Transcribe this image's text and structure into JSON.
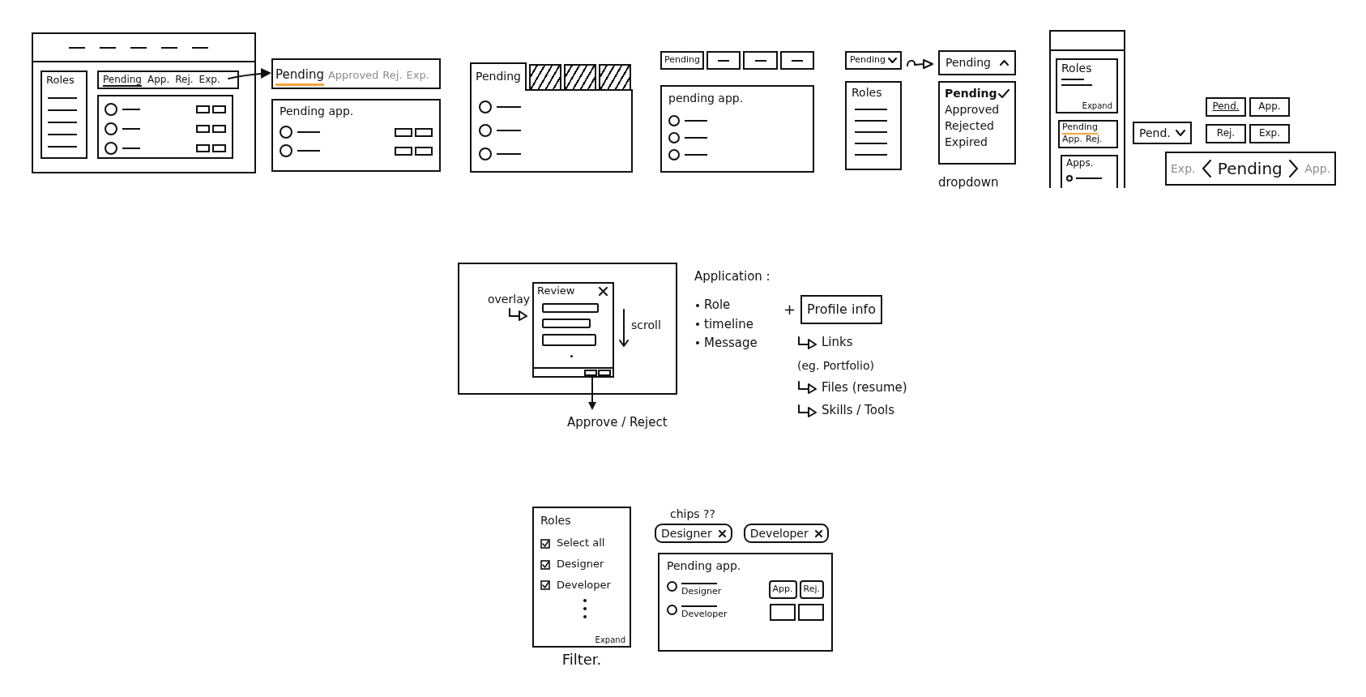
{
  "layout_sketch": {
    "sidebar_title": "Roles",
    "tabs": [
      {
        "label": "Pending",
        "selected": true
      },
      {
        "label": "App.",
        "selected": false
      },
      {
        "label": "Rej.",
        "selected": false
      },
      {
        "label": "Exp.",
        "selected": false
      }
    ]
  },
  "tab_detail": {
    "tabs": [
      {
        "label": "Pending",
        "selected": true
      },
      {
        "label": "Approved",
        "selected": false
      },
      {
        "label": "Rej.",
        "selected": false
      },
      {
        "label": "Exp.",
        "selected": false
      }
    ],
    "list_title": "Pending app."
  },
  "folder_tabs": {
    "tabs": [
      {
        "label": "Pending",
        "selected": true
      },
      {
        "selected": false
      },
      {
        "selected": false
      },
      {
        "selected": false
      }
    ]
  },
  "box_tabs": {
    "tabs": [
      {
        "kind": "text",
        "label": "Pending"
      },
      {
        "kind": "dash"
      },
      {
        "kind": "dash"
      },
      {
        "kind": "dash"
      }
    ],
    "list_title": "pending app."
  },
  "dropdown_sketch": {
    "dropdowns": [
      {
        "value": "Pending",
        "expanded": false
      },
      {
        "value": "Pending",
        "expanded": true
      }
    ],
    "sidebar_title": "Roles",
    "options": [
      {
        "label": "Pending",
        "selected": true
      },
      {
        "label": "Approved",
        "selected": false
      },
      {
        "label": "Rejected",
        "selected": false
      },
      {
        "label": "Expired",
        "selected": false
      }
    ],
    "caption": "dropdown"
  },
  "mobile_sketch": {
    "roles_card": {
      "title": "Roles",
      "action": "Expand"
    },
    "tabs": [
      {
        "label": "Pending",
        "selected": true
      },
      {
        "label": "App.",
        "selected": false
      },
      {
        "label": "Rej.",
        "selected": false
      }
    ],
    "apps_card": {
      "title": "Apps."
    }
  },
  "compact_dropdown": {
    "value": "Pend.",
    "expanded": false
  },
  "button_grid": [
    {
      "label": "Pend.",
      "selected": true
    },
    {
      "label": "App.",
      "selected": false
    },
    {
      "label": "Rej.",
      "selected": false
    },
    {
      "label": "Exp.",
      "selected": false
    }
  ],
  "carousel": {
    "previous": "Exp.",
    "current": "Pending",
    "next": "App."
  },
  "review_sketch": {
    "overlay_label": "overlay",
    "modal_title": "Review",
    "scroll_label": "scroll",
    "outcome": "Approve / Reject"
  },
  "application_notes": {
    "title": "Application :",
    "fields": [
      "Role",
      "timeline",
      "Message"
    ],
    "joiner": "+",
    "profile_title": "Profile info",
    "profile_items": [
      {
        "label": "Links",
        "note": "(eg. Portfolio)"
      },
      {
        "label": "Files (resume)"
      },
      {
        "label": "Skills / Tools"
      }
    ]
  },
  "filter_sketch": {
    "panel_title": "Roles",
    "options": [
      {
        "label": "Select all",
        "checked": true
      },
      {
        "label": "Designer",
        "checked": true
      },
      {
        "label": "Developer",
        "checked": true
      }
    ],
    "action": "Expand",
    "caption": "Filter."
  },
  "chips_sketch": {
    "note": "chips ??",
    "chips": [
      {
        "label": "Designer"
      },
      {
        "label": "Developer"
      }
    ],
    "list_title": "Pending app.",
    "rows": [
      {
        "role": "Designer",
        "actions": [
          "App.",
          "Rej."
        ]
      },
      {
        "role": "Developer"
      }
    ]
  }
}
